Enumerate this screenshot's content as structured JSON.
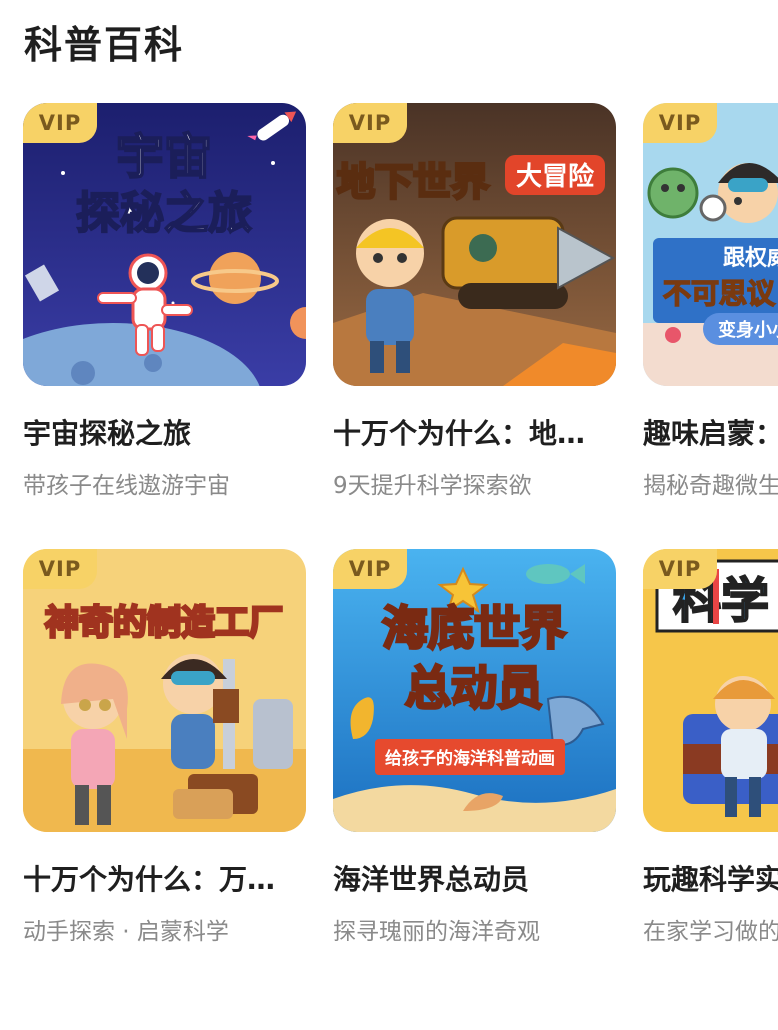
{
  "section": {
    "title": "科普百科"
  },
  "cards": [
    {
      "vip": "VIP",
      "cover_text": "宇宙探秘之旅",
      "title": "宇宙探秘之旅",
      "subtitle": "带孩子在线遨游宇宙",
      "bg": "#2b2f86"
    },
    {
      "vip": "VIP",
      "cover_text": "地下世界",
      "cover_badge": "大冒险",
      "title": "十万个为什么：地…",
      "subtitle": "9天提升科学探索欲",
      "bg": "#6b4a33"
    },
    {
      "vip": "VIP",
      "cover_text": "跟权威",
      "cover_text2": "不可思议",
      "cover_badge": "变身小小",
      "title": "趣味启蒙：",
      "subtitle": "揭秘奇趣微生",
      "bg": "#9fd3ea"
    },
    {
      "vip": "VIP",
      "cover_text": "神奇的制造工厂",
      "title": "十万个为什么：万…",
      "subtitle": "动手探索 · 启蒙科学",
      "bg": "#f4c86a"
    },
    {
      "vip": "VIP",
      "cover_text": "海底世界",
      "cover_text2": "总动员",
      "cover_badge": "给孩子的海洋科普动画",
      "title": "海洋世界总动员",
      "subtitle": "探寻瑰丽的海洋奇观",
      "bg": "#2e8fd6"
    },
    {
      "vip": "VIP",
      "cover_text": "科学",
      "title": "玩趣科学实",
      "subtitle": "在家学习做的",
      "bg": "#f6c64a"
    }
  ]
}
